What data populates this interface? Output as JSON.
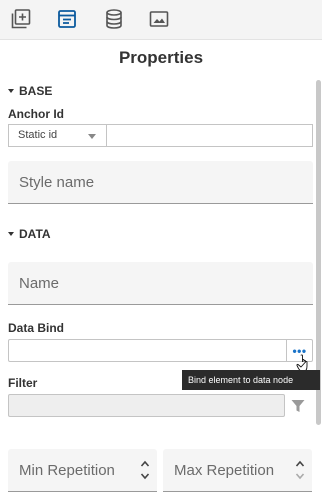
{
  "toolbar": {
    "icons": [
      "add-box-icon",
      "properties-panel-icon",
      "database-icon",
      "image-icon"
    ],
    "active": "properties-panel-icon"
  },
  "panel": {
    "title": "Properties"
  },
  "base": {
    "section_label": "BASE",
    "anchor_label": "Anchor Id",
    "anchor_select_value": "Static id",
    "anchor_value": "",
    "style_placeholder": "Style name"
  },
  "data": {
    "section_label": "DATA",
    "name_placeholder": "Name",
    "bind_label": "Data Bind",
    "bind_value": "",
    "bind_button": "•••",
    "tooltip": "Bind element to data node",
    "filter_label": "Filter",
    "min_placeholder": "Min Repetition",
    "max_placeholder": "Max Repetition"
  },
  "colors": {
    "accent": "#1a73c8",
    "active_icon": "#0b5a9e"
  }
}
